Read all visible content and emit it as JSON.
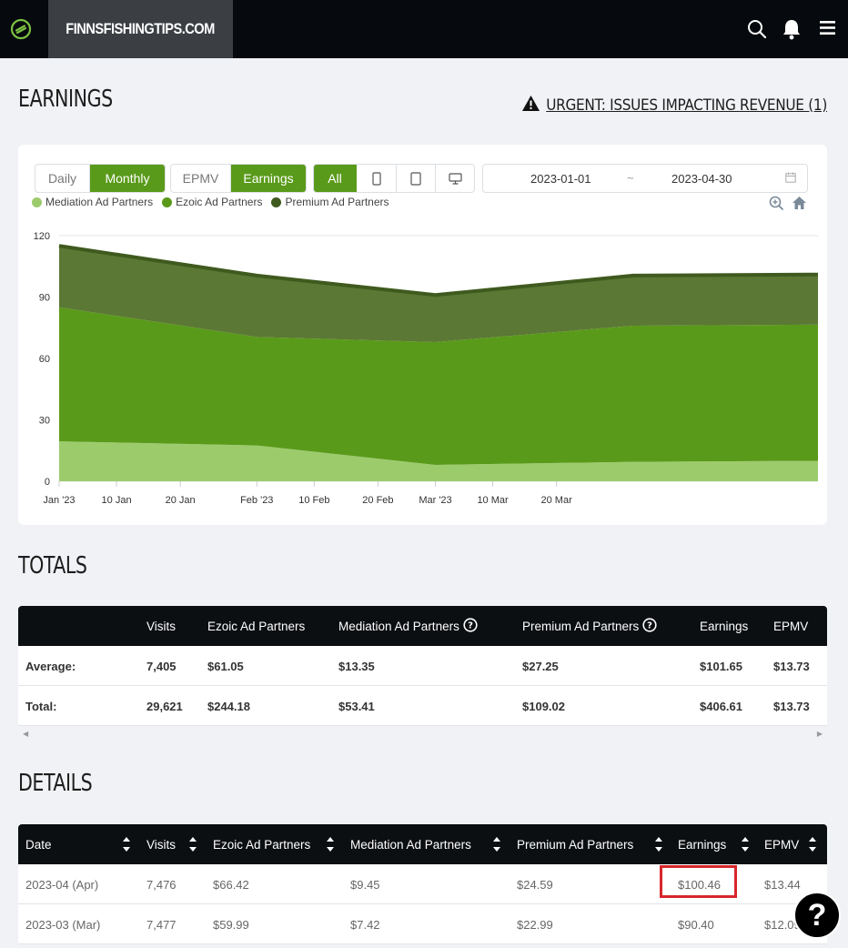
{
  "header": {
    "site_name": "FINNSFISHINGTIPS.COM",
    "icons": [
      "ezoic-logo-icon",
      "search-icon",
      "bell-icon",
      "menu-icon"
    ]
  },
  "earnings": {
    "title": "EARNINGS",
    "urgent_label": "URGENT: ISSUES IMPACTING REVENUE (1)",
    "period_buttons": [
      "Daily",
      "Monthly"
    ],
    "active_period": "Monthly",
    "metric_buttons": [
      "EPMV",
      "Earnings"
    ],
    "active_metric": "Earnings",
    "device_buttons": {
      "all": "All",
      "icons": [
        "mobile-icon",
        "tablet-icon",
        "desktop-icon"
      ]
    },
    "date_from": "2023-01-01",
    "date_sep": "~",
    "date_to": "2023-04-30"
  },
  "chart_data": {
    "type": "area",
    "stacked": true,
    "x": [
      "2023-01-01",
      "2023-02-01",
      "2023-03-01",
      "2023-04-01",
      "2023-04-30"
    ],
    "x_tick_labels": [
      "Jan '23",
      "10 Jan",
      "20 Jan",
      "Feb '23",
      "10 Feb",
      "20 Feb",
      "Mar '23",
      "10 Mar",
      "20 Mar"
    ],
    "x_tick_dates": [
      "2023-01-01",
      "2023-01-10",
      "2023-01-20",
      "2023-02-01",
      "2023-02-10",
      "2023-02-20",
      "2023-03-01",
      "2023-03-10",
      "2023-03-20"
    ],
    "y_ticks": [
      0,
      30,
      60,
      90,
      120
    ],
    "ylim": [
      0,
      120
    ],
    "grid": true,
    "legend_position": "top-left",
    "series": [
      {
        "name": "Mediation Ad Partners",
        "color": "#9ccb6c",
        "values": [
          19.5,
          17.5,
          8,
          9.5,
          10
        ]
      },
      {
        "name": "Ezoic Ad Partners",
        "color": "#5a9a1a",
        "values": [
          65.5,
          53,
          60,
          66.5,
          66.5
        ]
      },
      {
        "name": "Premium Ad Partners",
        "color": "#5b7834",
        "values": [
          30,
          30,
          23,
          24.5,
          24.5
        ]
      }
    ],
    "line_color": "#3f5a1e"
  },
  "totals": {
    "title": "TOTALS",
    "columns": [
      "",
      "Visits",
      "Ezoic Ad Partners",
      "Mediation Ad Partners",
      "Premium Ad Partners",
      "Earnings",
      "EPMV"
    ],
    "rows": [
      [
        "Average:",
        "7,405",
        "$61.05",
        "$13.35",
        "$27.25",
        "$101.65",
        "$13.73"
      ],
      [
        "Total:",
        "29,621",
        "$244.18",
        "$53.41",
        "$109.02",
        "$406.61",
        "$13.73"
      ]
    ]
  },
  "details": {
    "title": "DETAILS",
    "columns": [
      "Date",
      "Visits",
      "Ezoic Ad Partners",
      "Mediation Ad Partners",
      "Premium Ad Partners",
      "Earnings",
      "EPMV"
    ],
    "rows": [
      [
        "2023-04 (Apr)",
        "7,476",
        "$66.42",
        "$9.45",
        "$24.59",
        "$100.46",
        "$13.44"
      ],
      [
        "2023-03 (Mar)",
        "7,477",
        "$59.99",
        "$7.42",
        "$22.99",
        "$90.40",
        "$12.09"
      ]
    ]
  },
  "help_button": "?"
}
